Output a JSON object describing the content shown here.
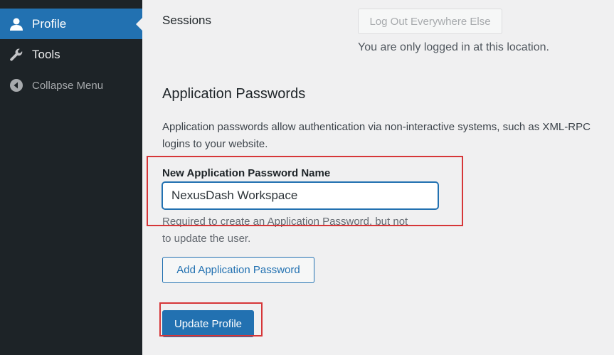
{
  "sidebar": {
    "items": [
      {
        "label": "Profile",
        "icon": "user-icon",
        "active": true
      },
      {
        "label": "Tools",
        "icon": "wrench-icon"
      },
      {
        "label": "Collapse Menu",
        "icon": "collapse-arrow-icon"
      }
    ]
  },
  "sessions": {
    "label": "Sessions",
    "logout_button": "Log Out Everywhere Else",
    "note": "You are only logged in at this location."
  },
  "app_passwords": {
    "title": "Application Passwords",
    "description_line1": "Application passwords allow authentication via non-interactive systems, such as XML-RPC",
    "description_line2": "logins to your website.",
    "field_label": "New Application Password Name",
    "field_value": "NexusDash Workspace",
    "help_line1": "Required to create an Application Password, but not",
    "help_line2": "to update the user.",
    "add_button": "Add Application Password"
  },
  "update_button": "Update Profile",
  "colors": {
    "sidebar_bg": "#1d2327",
    "accent": "#2271b1",
    "highlight": "#d63638"
  }
}
